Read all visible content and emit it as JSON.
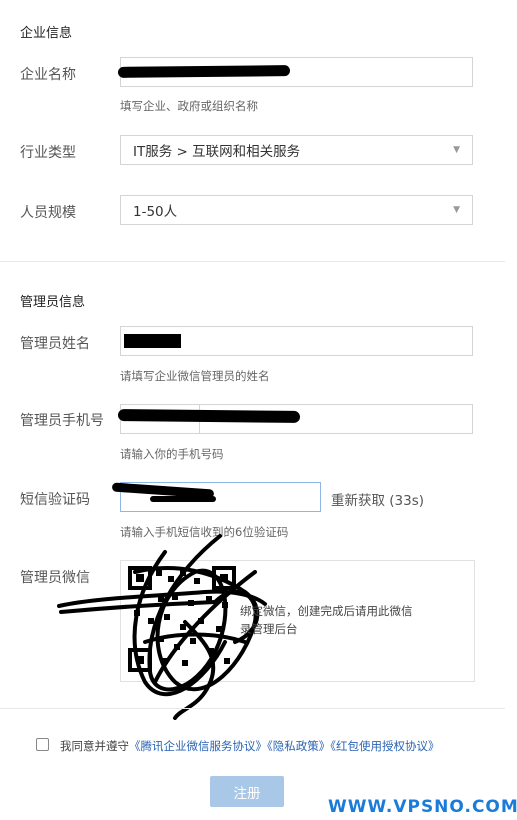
{
  "enterprise": {
    "section_title": "企业信息",
    "name_label": "企业名称",
    "name_value": "",
    "name_hint": "填写企业、政府或组织名称",
    "industry_label": "行业类型",
    "industry_value": "IT服务 > 互联网和相关服务",
    "size_label": "人员规模",
    "size_value": "1-50人"
  },
  "admin": {
    "section_title": "管理员信息",
    "name_label": "管理员姓名",
    "name_hint": "请填写企业微信管理员的姓名",
    "phone_label": "管理员手机号",
    "phone_hint": "请输入你的手机号码",
    "sms_label": "短信验证码",
    "resend_label": "重新获取 (33s)",
    "sms_hint": "请输入手机短信收到的6位验证码",
    "wechat_label": "管理员微信",
    "qr_note_line1": "绑定微信，创建完成后请用此微信",
    "qr_note_line2": "录管理后台"
  },
  "agreement": {
    "prefix": "我同意并遵守",
    "link1": "《腾讯企业微信服务协议》",
    "link2": "《隐私政策》",
    "link3": "《红包使用授权协议》",
    "checked": false
  },
  "register_label": "注册",
  "watermark": "WWW.VPSNO.COM",
  "colors": {
    "link": "#2b64b3",
    "button": "#a9c7e6",
    "watermark": "#1a7bd8"
  },
  "icons": {
    "select_caret": "caret-down-icon",
    "qr": "qr-code-icon"
  }
}
